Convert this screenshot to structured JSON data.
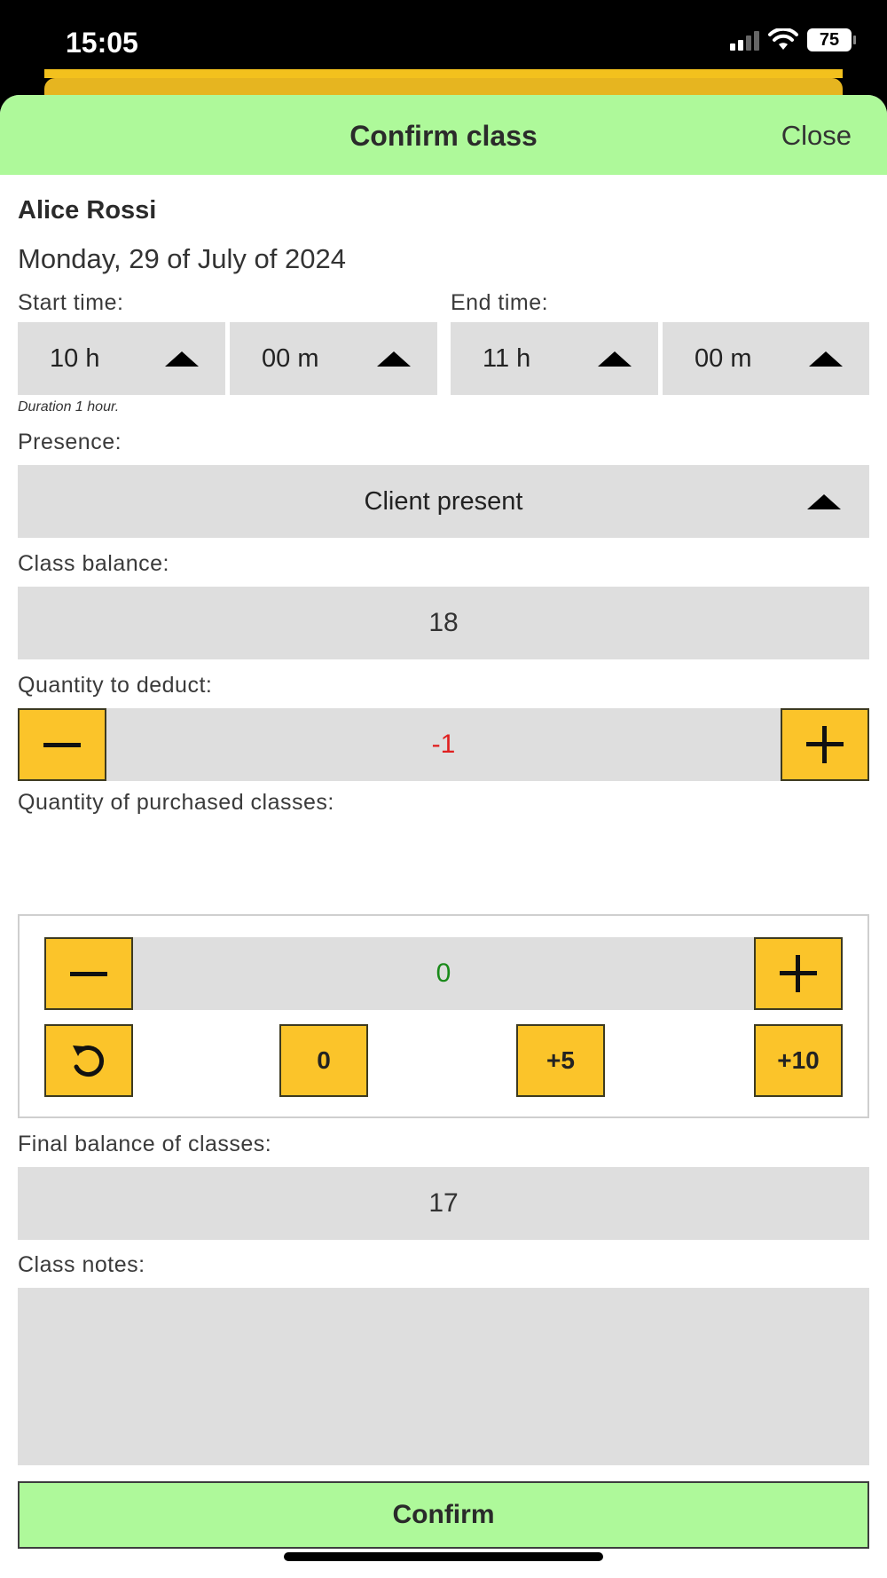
{
  "status_bar": {
    "time": "15:05",
    "battery": "75"
  },
  "sheet": {
    "title": "Confirm class",
    "close_label": "Close"
  },
  "client": {
    "name": "Alice Rossi",
    "date": "Monday, 29 of July of 2024"
  },
  "time": {
    "start_label": "Start time:",
    "end_label": "End time:",
    "start_hour": "10 h",
    "start_minute": "00 m",
    "end_hour": "11 h",
    "end_minute": "00 m",
    "duration_note": "Duration 1 hour."
  },
  "presence": {
    "label": "Presence:",
    "value": "Client present"
  },
  "class_balance": {
    "label": "Class balance:",
    "value": "18"
  },
  "deduct": {
    "label": "Quantity to deduct:",
    "value": "-1",
    "value_color": "#e02020"
  },
  "purchased": {
    "label": "Quantity of purchased classes:",
    "value": "0",
    "value_color": "#1a8a1a",
    "quick_buttons": [
      "0",
      "+5",
      "+10"
    ]
  },
  "final_balance": {
    "label": "Final balance of classes:",
    "value": "17"
  },
  "notes": {
    "label": "Class notes:",
    "value": ""
  },
  "confirm_label": "Confirm",
  "colors": {
    "header_green": "#aef99a",
    "button_yellow": "#fbc42a",
    "field_grey": "#dedede"
  }
}
